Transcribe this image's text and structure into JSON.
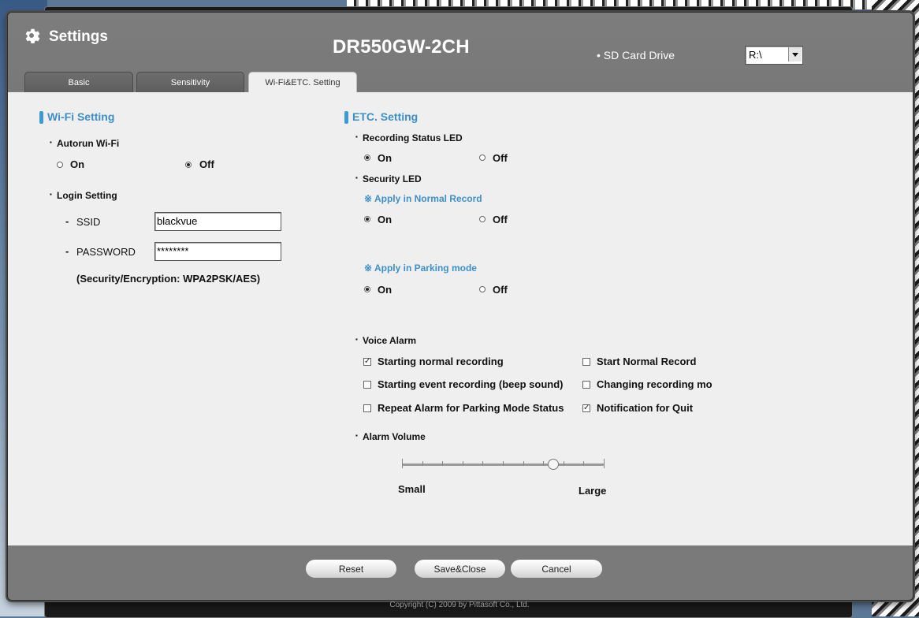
{
  "window": {
    "title": "Settings",
    "model": "DR550GW-2CH",
    "sd_label": "SD Card Drive",
    "sd_value": "R:\\"
  },
  "tabs": [
    {
      "label": "Basic",
      "active": false
    },
    {
      "label": "Sensitivity",
      "active": false
    },
    {
      "label": "Wi-Fi&ETC. Setting",
      "active": true
    }
  ],
  "wifi": {
    "section_title": "Wi-Fi Setting",
    "autorun_label": "Autorun Wi-Fi",
    "autorun_on": "On",
    "autorun_off": "Off",
    "autorun_selected": "Off",
    "login_label": "Login Setting",
    "ssid_label": "SSID",
    "ssid_value": "blackvue",
    "password_label": "PASSWORD",
    "password_value": "********",
    "security_note": "(Security/Encryption: WPA2PSK/AES)"
  },
  "etc": {
    "section_title": "ETC. Setting",
    "recording_led_label": "Recording Status LED",
    "recording_led_selected": "On",
    "security_led_label": "Security LED",
    "normal_record_note": "Apply in Normal Record",
    "normal_record_selected": "On",
    "parking_mode_note": "Apply in Parking mode",
    "parking_mode_selected": "On",
    "on_label": "On",
    "off_label": "Off",
    "note_symbol": "※",
    "voice_alarm_label": "Voice Alarm",
    "voice_alarms": [
      {
        "label": "Starting normal recording",
        "checked": true
      },
      {
        "label": "Start Normal Record",
        "checked": false
      },
      {
        "label": "Starting event recording (beep sound)",
        "checked": false
      },
      {
        "label": "Changing recording mo",
        "checked": false
      },
      {
        "label": "Repeat Alarm for Parking Mode Status",
        "checked": false
      },
      {
        "label": "Notification for Quit",
        "checked": true
      }
    ],
    "alarm_volume_label": "Alarm Volume",
    "volume_small": "Small",
    "volume_large": "Large",
    "volume_level": 0.75
  },
  "footer": {
    "reset": "Reset",
    "save_close": "Save&Close",
    "cancel": "Cancel",
    "copyright": "Copyright (C) 2009 by Pittasoft Co., Ltd."
  },
  "colors": {
    "accent": "#3c8fc8",
    "chrome": "#7e7e7e",
    "panel": "#efefef"
  }
}
